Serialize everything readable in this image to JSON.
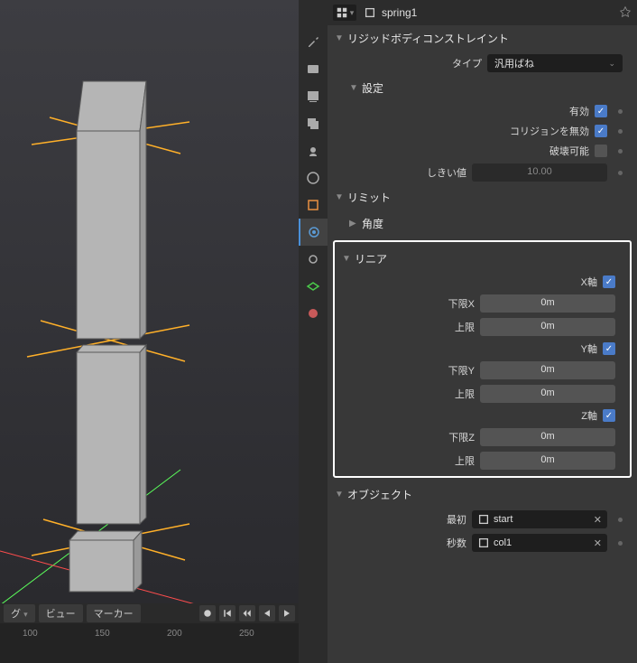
{
  "header": {
    "object_name": "spring1"
  },
  "panel": {
    "title": "リジッドボディコンストレイント",
    "type_label": "タイプ",
    "type_value": "汎用ばね",
    "settings": {
      "title": "設定",
      "enabled_label": "有効",
      "disable_collisions_label": "コリジョンを無効",
      "breakable_label": "破壊可能",
      "threshold_label": "しきい値",
      "threshold_value": "10.00"
    },
    "limits": {
      "title": "リミット",
      "angular": "角度"
    },
    "linear": {
      "title": "リニア",
      "x_axis": "X軸",
      "lower_x": "下限X",
      "lower_x_val": "0m",
      "upper_x_label": "上限",
      "upper_x_val": "0m",
      "y_axis": "Y軸",
      "lower_y": "下限Y",
      "lower_y_val": "0m",
      "upper_y_label": "上限",
      "upper_y_val": "0m",
      "z_axis": "Z軸",
      "lower_z": "下限Z",
      "lower_z_val": "0m",
      "upper_z_label": "上限",
      "upper_z_val": "0m"
    },
    "objects": {
      "title": "オブジェクト",
      "first_label": "最初",
      "first_value": "start",
      "second_label": "秒数",
      "second_value": "col1"
    }
  },
  "timeline": {
    "drag_label": "グ",
    "view": "ビュー",
    "marker": "マーカー",
    "ticks": [
      "100",
      "150",
      "200",
      "250"
    ]
  }
}
